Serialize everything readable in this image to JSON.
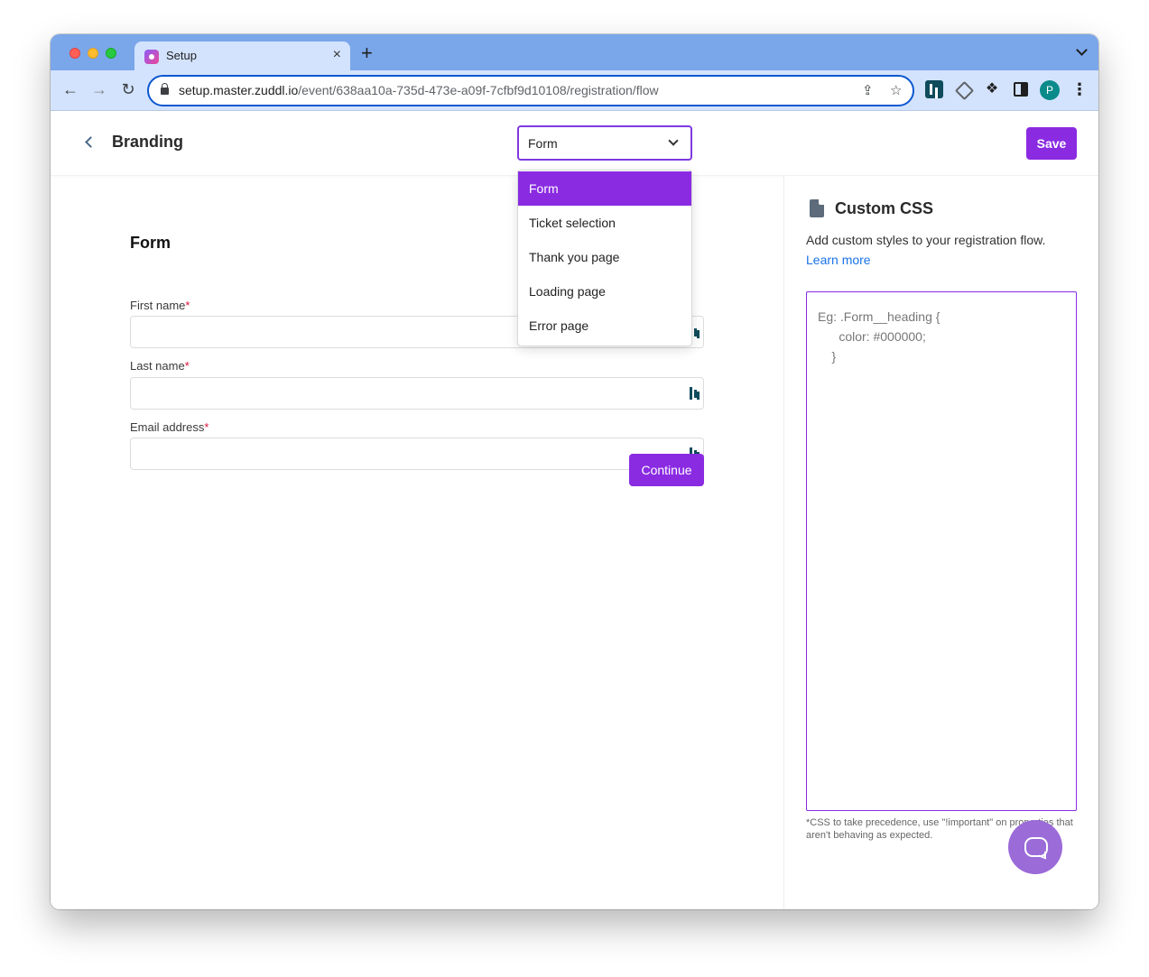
{
  "browser": {
    "tab_title": "Setup",
    "tab_close": "×",
    "new_tab": "+",
    "url_host": "setup.master.zuddl.io",
    "url_path": "/event/638aa10a-735d-473e-a09f-7cfbf9d10108/registration/flow",
    "profile_initial": "P"
  },
  "header": {
    "title": "Branding",
    "selected_page": "Form",
    "save_label": "Save"
  },
  "dropdown": {
    "options": [
      "Form",
      "Ticket selection",
      "Thank you page",
      "Loading page",
      "Error page"
    ]
  },
  "form": {
    "title": "Form",
    "fields": [
      {
        "label": "First name",
        "required_mark": "*",
        "value": ""
      },
      {
        "label": "Last name",
        "required_mark": "*",
        "value": ""
      },
      {
        "label": "Email address",
        "required_mark": "*",
        "value": ""
      }
    ],
    "continue_label": "Continue"
  },
  "sidebar": {
    "title": "Custom CSS",
    "description": "Add custom styles to your registration flow.",
    "learn_more": "Learn more",
    "placeholder_lines": [
      "Eg: .Form__heading {",
      "      color: #000000;",
      "    }"
    ],
    "note": "*CSS to take precedence, use \"!important\" on properties that aren't behaving as expected."
  },
  "colors": {
    "accent": "#8a2be2",
    "link": "#1a73e8",
    "required": "#e0143c"
  },
  "icons": {
    "back": "chevron-left-icon",
    "select": "chevron-down-icon",
    "doc": "document-icon",
    "chat": "chat-bubble-icon"
  }
}
